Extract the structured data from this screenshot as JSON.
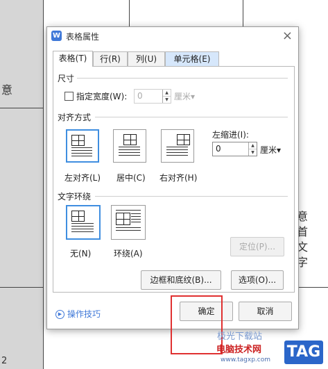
{
  "dialog": {
    "title": "表格属性",
    "app_icon": "W",
    "close_icon": "×"
  },
  "tabs": [
    {
      "label": "表格(T)"
    },
    {
      "label": "行(R)"
    },
    {
      "label": "列(U)"
    },
    {
      "label": "单元格(E)"
    }
  ],
  "size": {
    "section_label": "尺寸",
    "width_checkbox_label": "指定宽度(W):",
    "width_value": "0",
    "width_unit": "厘米▾"
  },
  "alignment": {
    "section_label": "对齐方式",
    "options": [
      {
        "label": "左对齐(L)",
        "selected": true
      },
      {
        "label": "居中(C)",
        "selected": false
      },
      {
        "label": "右对齐(H)",
        "selected": false
      }
    ],
    "indent_label": "左缩进(I):",
    "indent_value": "0",
    "indent_unit": "厘米▾"
  },
  "wrapping": {
    "section_label": "文字环绕",
    "options": [
      {
        "label": "无(N)",
        "selected": true
      },
      {
        "label": "环绕(A)",
        "selected": false
      }
    ],
    "position_button": "定位(P)..."
  },
  "buttons": {
    "borders": "边框和底纹(B)...",
    "options": "选项(O)...",
    "ok": "确定",
    "cancel": "取消"
  },
  "tips": {
    "label": "操作技巧"
  },
  "background": {
    "chars_right": [
      "意",
      "首",
      "文",
      "字"
    ],
    "char_left_top": "意",
    "char_left_bottom": "2"
  },
  "watermark": {
    "line1": "电脑技术网",
    "line2": "www.tagxp.com",
    "badge": "TAG",
    "line0": "极光下载站"
  },
  "colors": {
    "accent": "#3f78d8",
    "selected_border": "#3f8ee0",
    "highlight_box": "#e03030"
  }
}
